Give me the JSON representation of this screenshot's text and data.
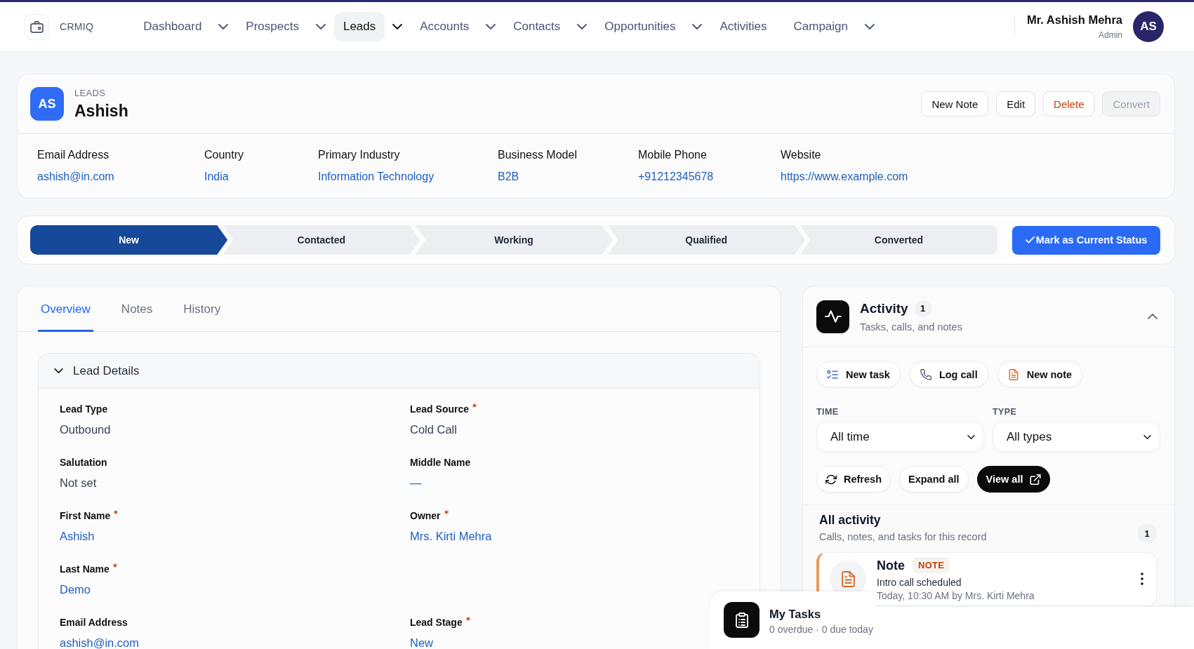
{
  "nav": {
    "logo_text": "CRMIQ",
    "items": [
      {
        "label": "Dashboard",
        "selected": false,
        "has_menu": true
      },
      {
        "label": "Prospects",
        "selected": false,
        "has_menu": true
      },
      {
        "label": "Leads",
        "selected": true,
        "has_menu": true
      },
      {
        "label": "Accounts",
        "selected": false,
        "has_menu": true
      },
      {
        "label": "Contacts",
        "selected": false,
        "has_menu": true
      },
      {
        "label": "Opportunities",
        "selected": false,
        "has_menu": true
      },
      {
        "label": "Activities",
        "selected": false,
        "has_menu": false
      },
      {
        "label": "Campaign",
        "selected": false,
        "has_menu": true
      }
    ],
    "user": {
      "name": "Mr. Ashish Mehra",
      "role": "Admin",
      "initials": "AS"
    }
  },
  "record": {
    "initials": "AS",
    "breadcrumb": "LEADS",
    "title": "Ashish",
    "actions": [
      {
        "label": "New Note",
        "kind": "default",
        "disabled": false
      },
      {
        "label": "Edit",
        "kind": "default",
        "disabled": false
      },
      {
        "label": "Delete",
        "kind": "danger",
        "disabled": false
      },
      {
        "label": "Convert",
        "kind": "default",
        "disabled": true
      }
    ],
    "fields": [
      {
        "label": "Email Address",
        "value": "ashish@in.com"
      },
      {
        "label": "Country",
        "value": "India"
      },
      {
        "label": "Primary Industry",
        "value": "Information Technology"
      },
      {
        "label": "Business Model",
        "value": "B2B"
      },
      {
        "label": "Mobile Phone",
        "value": "+91212345678"
      },
      {
        "label": "Website",
        "value": "https://www.example.com"
      }
    ]
  },
  "status_path": {
    "steps": [
      {
        "label": "New",
        "selected": true
      },
      {
        "label": "Contacted",
        "selected": false
      },
      {
        "label": "Working",
        "selected": false
      },
      {
        "label": "Qualified",
        "selected": false
      },
      {
        "label": "Converted",
        "selected": false
      }
    ],
    "action": "Mark as Current Status"
  },
  "tabs": [
    {
      "label": "Overview",
      "selected": true
    },
    {
      "label": "Notes",
      "selected": false
    },
    {
      "label": "History",
      "selected": false
    }
  ],
  "lead_details": {
    "title": "Lead Details",
    "expanded": true,
    "rows": [
      {
        "left": {
          "label": "Lead Type",
          "value": "Outbound",
          "kind": "text",
          "required": false
        },
        "right": {
          "label": "Lead Source",
          "value": "Cold Call",
          "kind": "text",
          "required": true
        }
      },
      {
        "left": {
          "label": "Salutation",
          "value": "Not set",
          "kind": "text",
          "required": false
        },
        "right": {
          "label": "Middle Name",
          "value": "—",
          "kind": "link",
          "required": false
        }
      },
      {
        "left": {
          "label": "First Name",
          "value": "Ashish",
          "kind": "link",
          "required": true
        },
        "right": {
          "label": "Owner",
          "value": "Mrs. Kirti Mehra",
          "kind": "link",
          "required": true
        }
      },
      {
        "left": {
          "label": "Last Name",
          "value": "Demo",
          "kind": "link",
          "required": true
        }
      },
      {
        "left": {
          "label": "Email Address",
          "value": "ashish@in.com",
          "kind": "link",
          "required": false
        },
        "right": {
          "label": "Lead Stage",
          "value": "New",
          "kind": "link",
          "required": true
        }
      }
    ]
  },
  "activity": {
    "title": "Activity",
    "count": "1",
    "subtitle": "Tasks, calls, and notes",
    "expanded": true,
    "quick_actions": [
      {
        "label": "New task",
        "kind": "task"
      },
      {
        "label": "Log call",
        "kind": "call"
      },
      {
        "label": "New note",
        "kind": "note"
      }
    ],
    "filters": [
      {
        "label": "TIME",
        "value": "All time"
      },
      {
        "label": "TYPE",
        "value": "All types"
      }
    ],
    "tools": [
      {
        "label": "Refresh",
        "kind": "refresh"
      },
      {
        "label": "Expand all",
        "kind": "plain"
      },
      {
        "label": "View all",
        "kind": "view"
      }
    ],
    "list": {
      "title": "All activity",
      "subtitle": "Calls, notes, and tasks for this record",
      "count": "1",
      "items": [
        {
          "kind": "note",
          "title": "Note",
          "tag": "NOTE",
          "text": "Intro call scheduled",
          "meta": "Today, 10:30 AM by Mrs. Kirti Mehra"
        }
      ]
    }
  },
  "my_tasks": {
    "title": "My Tasks",
    "summary": "0 overdue · 0 due today"
  }
}
